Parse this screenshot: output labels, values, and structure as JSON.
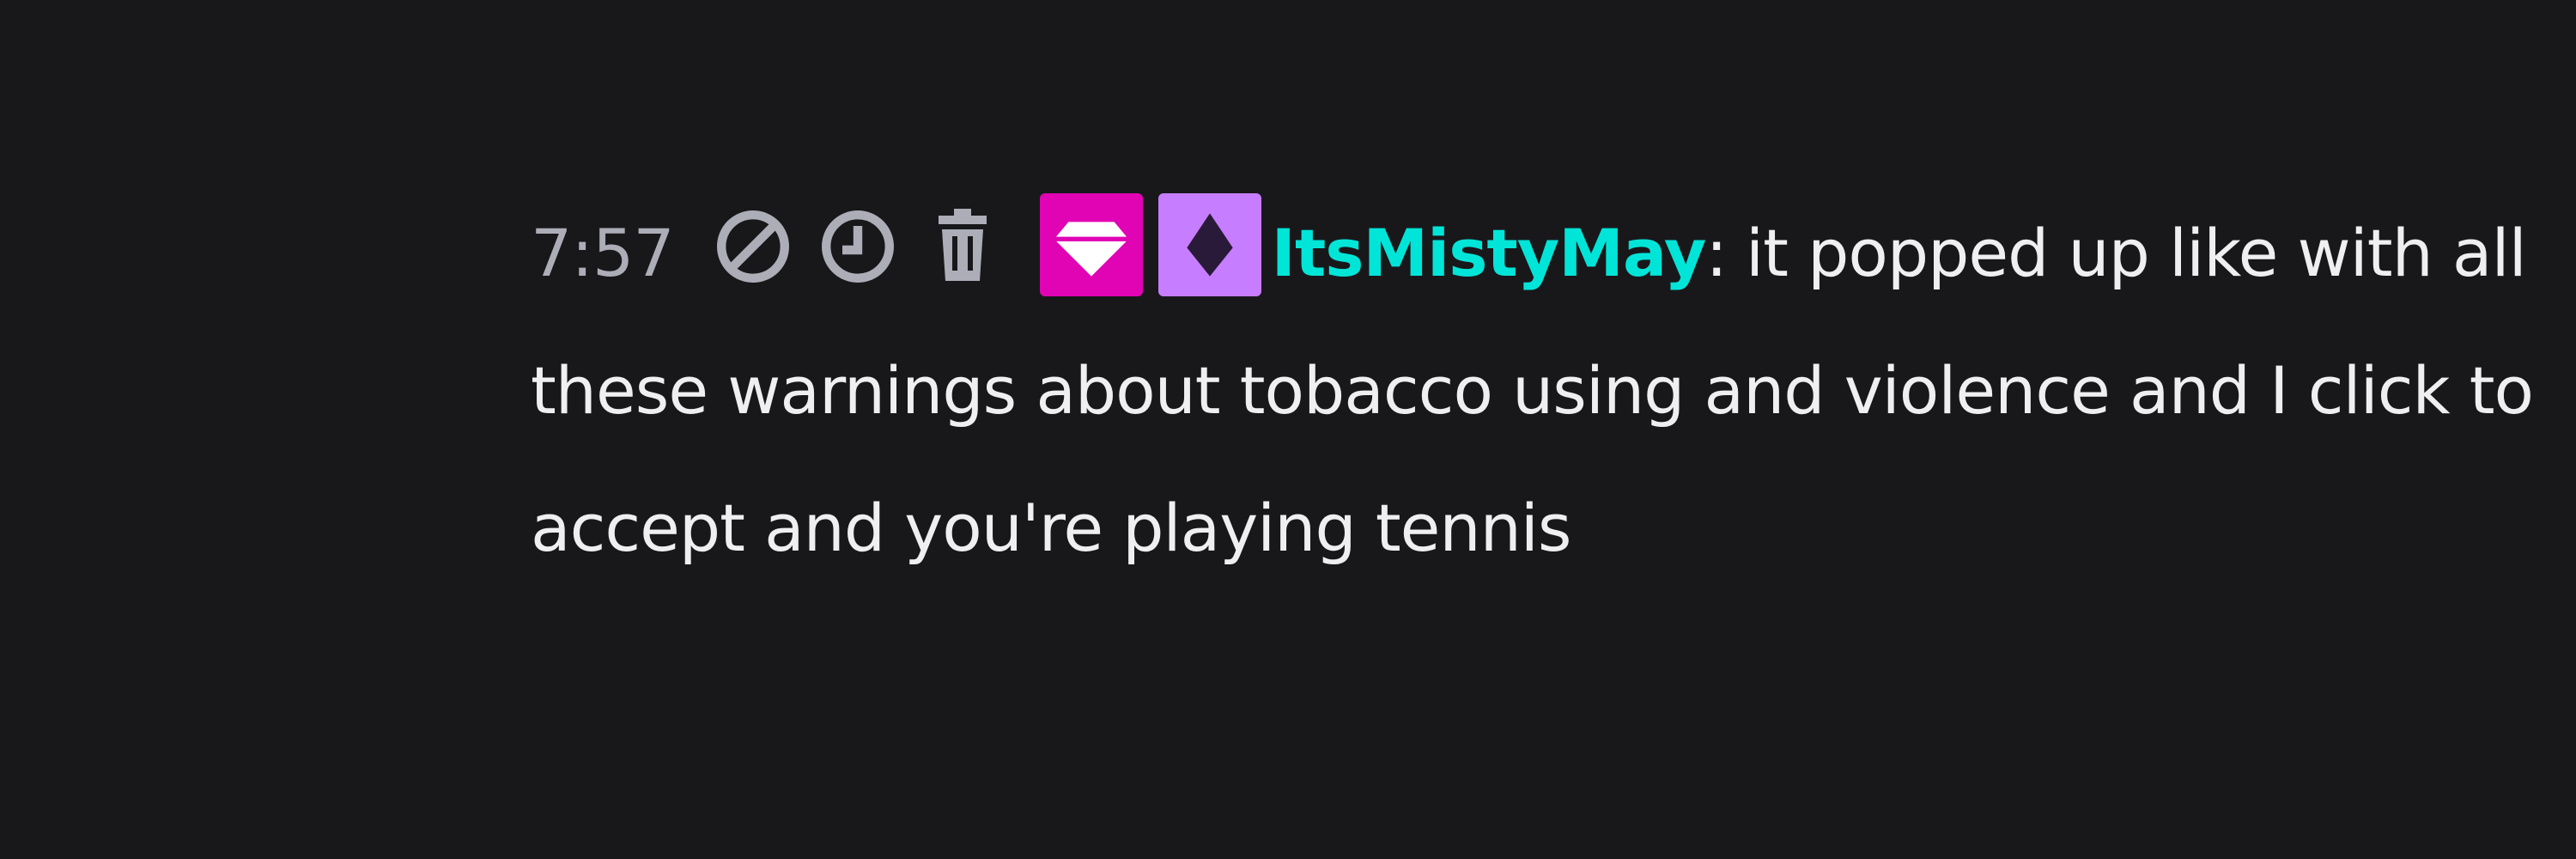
{
  "message": {
    "timestamp": "7:57",
    "username": "ItsMistyMay",
    "separator": ":",
    "text": "it popped up like with all these warnings about tobacco using and violence and I click to accept and you're playing tennis"
  },
  "mod_actions": [
    {
      "name": "ban-icon",
      "label": "ban"
    },
    {
      "name": "timeout-icon",
      "label": "timeout"
    },
    {
      "name": "delete-icon",
      "label": "delete"
    }
  ],
  "badges": [
    {
      "name": "gem-badge",
      "icon": "diamond-gem",
      "color": "#e004b4"
    },
    {
      "name": "prime-badge",
      "icon": "crown-diamond",
      "color": "#c77dff"
    }
  ],
  "colors": {
    "background": "#18181b",
    "text": "#efeff1",
    "timestamp": "#adadb8",
    "icon": "#adadb8",
    "username": "#00e5d8"
  }
}
